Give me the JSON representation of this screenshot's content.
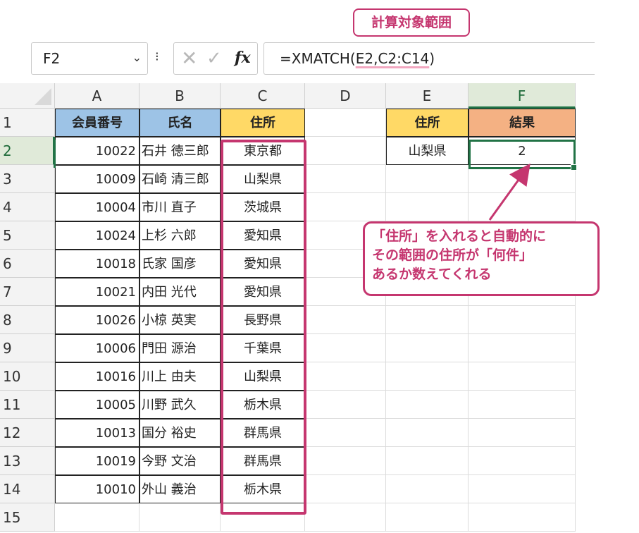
{
  "formula_bar": {
    "name_box": "F2",
    "cancel_glyph": "✕",
    "enter_glyph": "✓",
    "fx_label": "fx",
    "formula_prefix": "=XMATCH(",
    "formula_args": "E2,C2:C14",
    "formula_suffix": ")"
  },
  "columns": [
    "A",
    "B",
    "C",
    "D",
    "E",
    "F"
  ],
  "rows": [
    "1",
    "2",
    "3",
    "4",
    "5",
    "6",
    "7",
    "8",
    "9",
    "10",
    "11",
    "12",
    "13",
    "14",
    "15"
  ],
  "table": {
    "headers": [
      "会員番号",
      "氏名",
      "住所"
    ],
    "records": [
      [
        "10022",
        "石井 徳三郎",
        "東京都"
      ],
      [
        "10009",
        "石崎 清三郎",
        "山梨県"
      ],
      [
        "10004",
        "市川 直子",
        "茨城県"
      ],
      [
        "10024",
        "上杉 六郎",
        "愛知県"
      ],
      [
        "10018",
        "氏家 国彦",
        "愛知県"
      ],
      [
        "10021",
        "内田 光代",
        "愛知県"
      ],
      [
        "10026",
        "小椋 英実",
        "長野県"
      ],
      [
        "10006",
        "門田 源治",
        "千葉県"
      ],
      [
        "10016",
        "川上 由夫",
        "山梨県"
      ],
      [
        "10005",
        "川野 武久",
        "栃木県"
      ],
      [
        "10013",
        "国分 裕史",
        "群馬県"
      ],
      [
        "10019",
        "今野 文治",
        "群馬県"
      ],
      [
        "10010",
        "外山 義治",
        "栃木県"
      ]
    ]
  },
  "lookup": {
    "header_e": "住所",
    "header_f": "結果",
    "input_value": "山梨県",
    "result_value": "2"
  },
  "callouts": {
    "range_label": "計算対象範囲",
    "note": "「住所」を入れると自動的に\nその範囲の住所が「何件」\nあるか数えてくれる"
  },
  "colors": {
    "accent": "#c5366f",
    "selection_green": "#217346",
    "header_blue": "#9dc3e6",
    "header_yellow": "#ffd966",
    "header_orange": "#f4b183"
  }
}
